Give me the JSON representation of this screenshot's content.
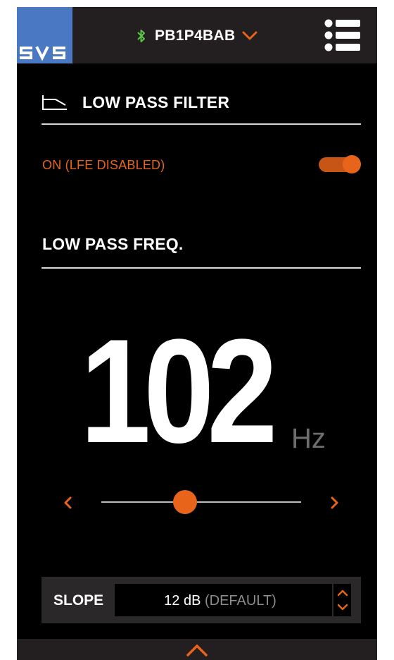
{
  "header": {
    "logo_text": "SVS",
    "device_name": "PB1P4BAB",
    "icons": {
      "bluetooth": "bluetooth-icon",
      "device_dropdown": "chevron-down-icon",
      "menu": "list-menu-icon"
    }
  },
  "low_pass_filter": {
    "title": "LOW PASS FILTER",
    "icon": "low-pass-filter-icon",
    "status": "ON (LFE DISABLED)",
    "enabled": true
  },
  "low_pass_freq": {
    "title": "LOW PASS FREQ.",
    "value": "102",
    "unit": "Hz",
    "slider_fraction": 0.42,
    "icons": {
      "decrease": "chevron-left-icon",
      "increase": "chevron-right-icon"
    }
  },
  "slope": {
    "label": "SLOPE",
    "value": "12 dB",
    "default_hint": "(DEFAULT)",
    "icon": "chevron-up-down-icon"
  },
  "bottom_bar": {
    "icon": "chevron-up-icon"
  },
  "colors": {
    "accent": "#e8641a",
    "header_bg": "#231f20",
    "logo_bg": "#4a78c2",
    "bluetooth": "#5fc44a",
    "background": "#000000",
    "panel": "#2b2829"
  }
}
